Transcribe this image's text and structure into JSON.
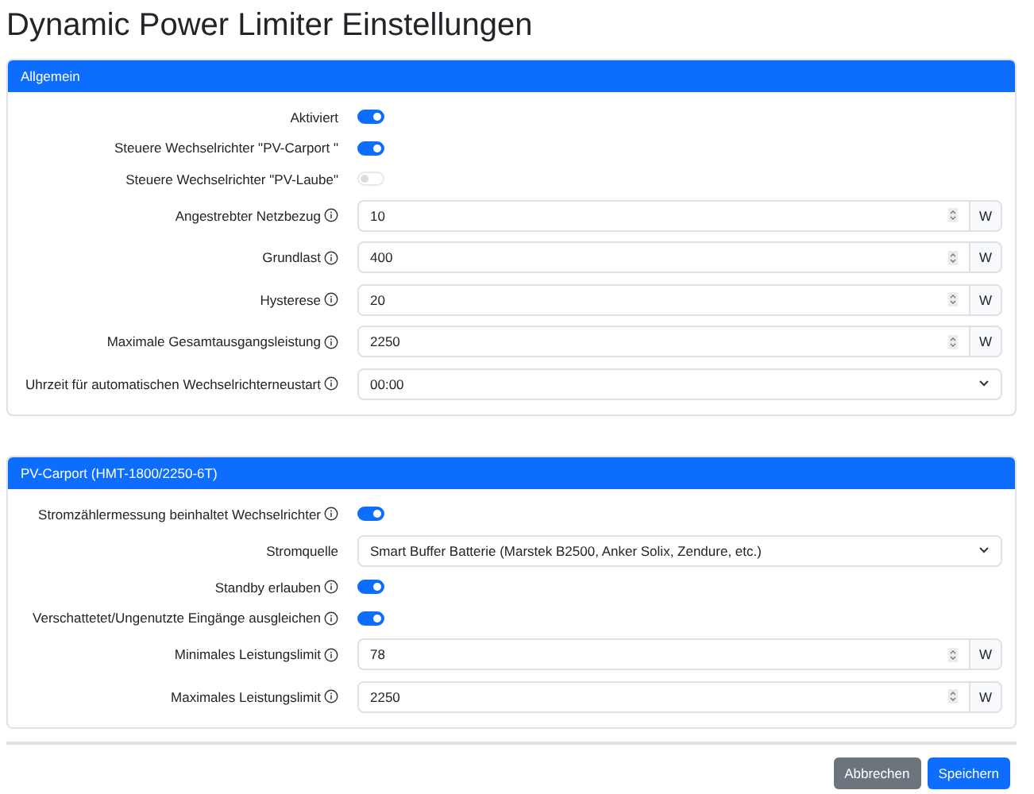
{
  "title": "Dynamic Power Limiter Einstellungen",
  "cards": [
    {
      "header": "Allgemein",
      "rows": [
        {
          "kind": "toggle",
          "label": "Aktiviert",
          "info": false,
          "on": true,
          "disabled": false
        },
        {
          "kind": "toggle",
          "label": "Steuere Wechselrichter \"PV-Carport \"",
          "info": false,
          "on": true,
          "disabled": false
        },
        {
          "kind": "toggle",
          "label": "Steuere Wechselrichter \"PV-Laube\"",
          "info": false,
          "on": false,
          "disabled": true
        },
        {
          "kind": "number",
          "label": "Angestrebter Netzbezug",
          "info": true,
          "value": "10",
          "unit": "W"
        },
        {
          "kind": "number",
          "label": "Grundlast",
          "info": true,
          "value": "400",
          "unit": "W"
        },
        {
          "kind": "number",
          "label": "Hysterese",
          "info": true,
          "value": "20",
          "unit": "W"
        },
        {
          "kind": "number",
          "label": "Maximale Gesamtausgangsleistung",
          "info": true,
          "value": "2250",
          "unit": "W"
        },
        {
          "kind": "select",
          "label": "Uhrzeit für automatischen Wechselrichterneustart",
          "info": true,
          "value": "00:00"
        }
      ]
    },
    {
      "header": "PV-Carport (HMT-1800/2250-6T)",
      "rows": [
        {
          "kind": "toggle",
          "label": "Stromzählermessung beinhaltet Wechselrichter",
          "info": true,
          "on": true,
          "disabled": false
        },
        {
          "kind": "select",
          "label": "Stromquelle",
          "info": false,
          "value": "Smart Buffer Batterie (Marstek B2500, Anker Solix, Zendure, etc.)"
        },
        {
          "kind": "toggle",
          "label": "Standby erlauben",
          "info": true,
          "on": true,
          "disabled": false
        },
        {
          "kind": "toggle",
          "label": "Verschattetet/Ungenutzte Eingänge ausgleichen",
          "info": true,
          "on": true,
          "disabled": false
        },
        {
          "kind": "number",
          "label": "Minimales Leistungslimit",
          "info": true,
          "value": "78",
          "unit": "W"
        },
        {
          "kind": "number",
          "label": "Maximales Leistungslimit",
          "info": true,
          "value": "2250",
          "unit": "W"
        }
      ]
    }
  ],
  "buttons": [
    {
      "label": "Abbrechen",
      "kind": "secondary"
    },
    {
      "label": "Speichern",
      "kind": "primary"
    }
  ]
}
